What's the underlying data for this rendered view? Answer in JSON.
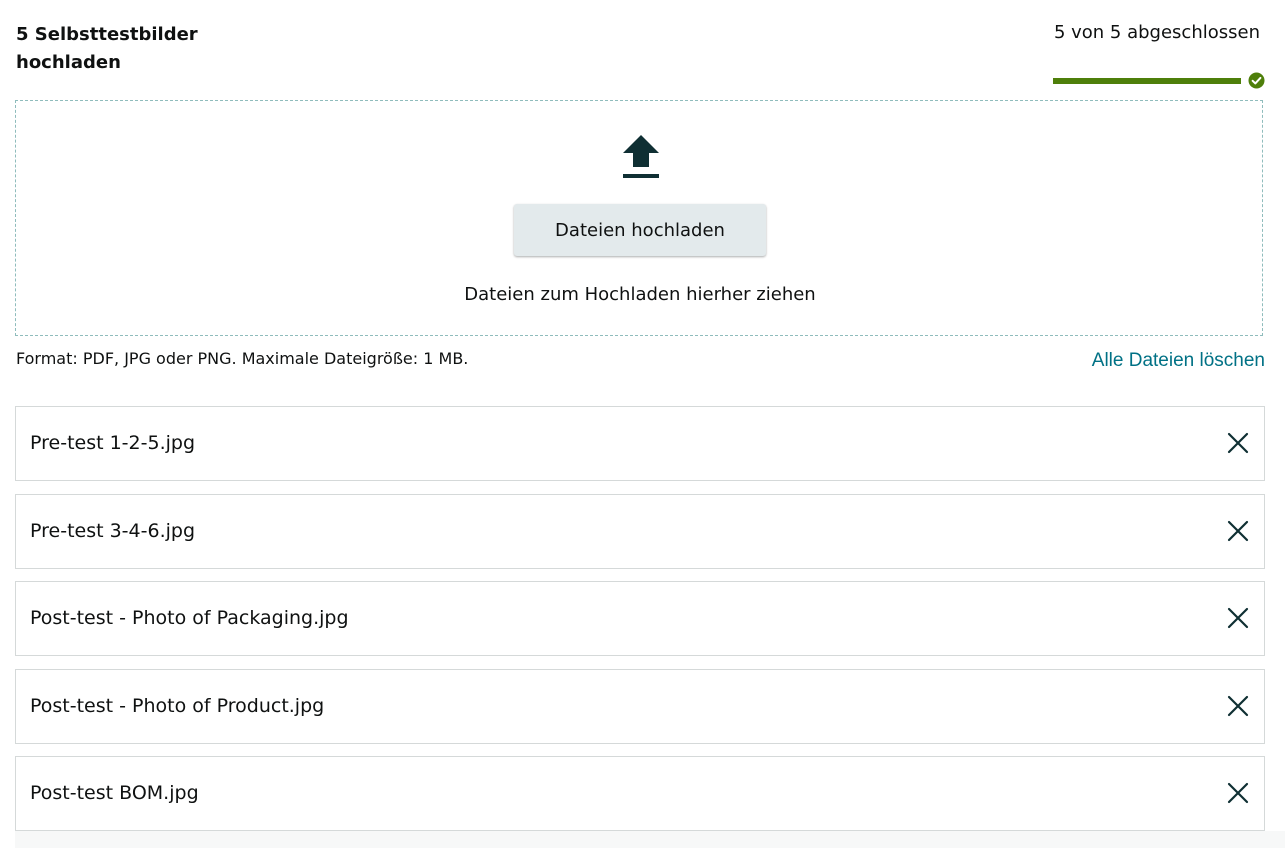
{
  "header": {
    "title": "5 Selbsttestbilder hochladen",
    "progress_text": "5 von 5 abgeschlossen",
    "progress_fraction": 1.0,
    "progress_complete_icon": "check-circle-icon",
    "progress_color": "#4e7f0a"
  },
  "dropzone": {
    "icon": "upload-icon",
    "button_label": "Dateien hochladen",
    "drop_text": "Dateien zum Hochladen hierher ziehen"
  },
  "info": {
    "format_text": "Format: PDF, JPG oder PNG. Maximale Dateigröße: 1 MB.",
    "clear_all_label": "Alle Dateien löschen",
    "link_color": "#007185"
  },
  "files": [
    {
      "name": "Pre-test 1-2-5.jpg",
      "remove_icon": "close-icon"
    },
    {
      "name": "Pre-test 3-4-6.jpg",
      "remove_icon": "close-icon"
    },
    {
      "name": "Post-test - Photo of Packaging.jpg",
      "remove_icon": "close-icon"
    },
    {
      "name": "Post-test - Photo of Product.jpg",
      "remove_icon": "close-icon"
    },
    {
      "name": "Post-test BOM.jpg",
      "remove_icon": "close-icon"
    }
  ]
}
